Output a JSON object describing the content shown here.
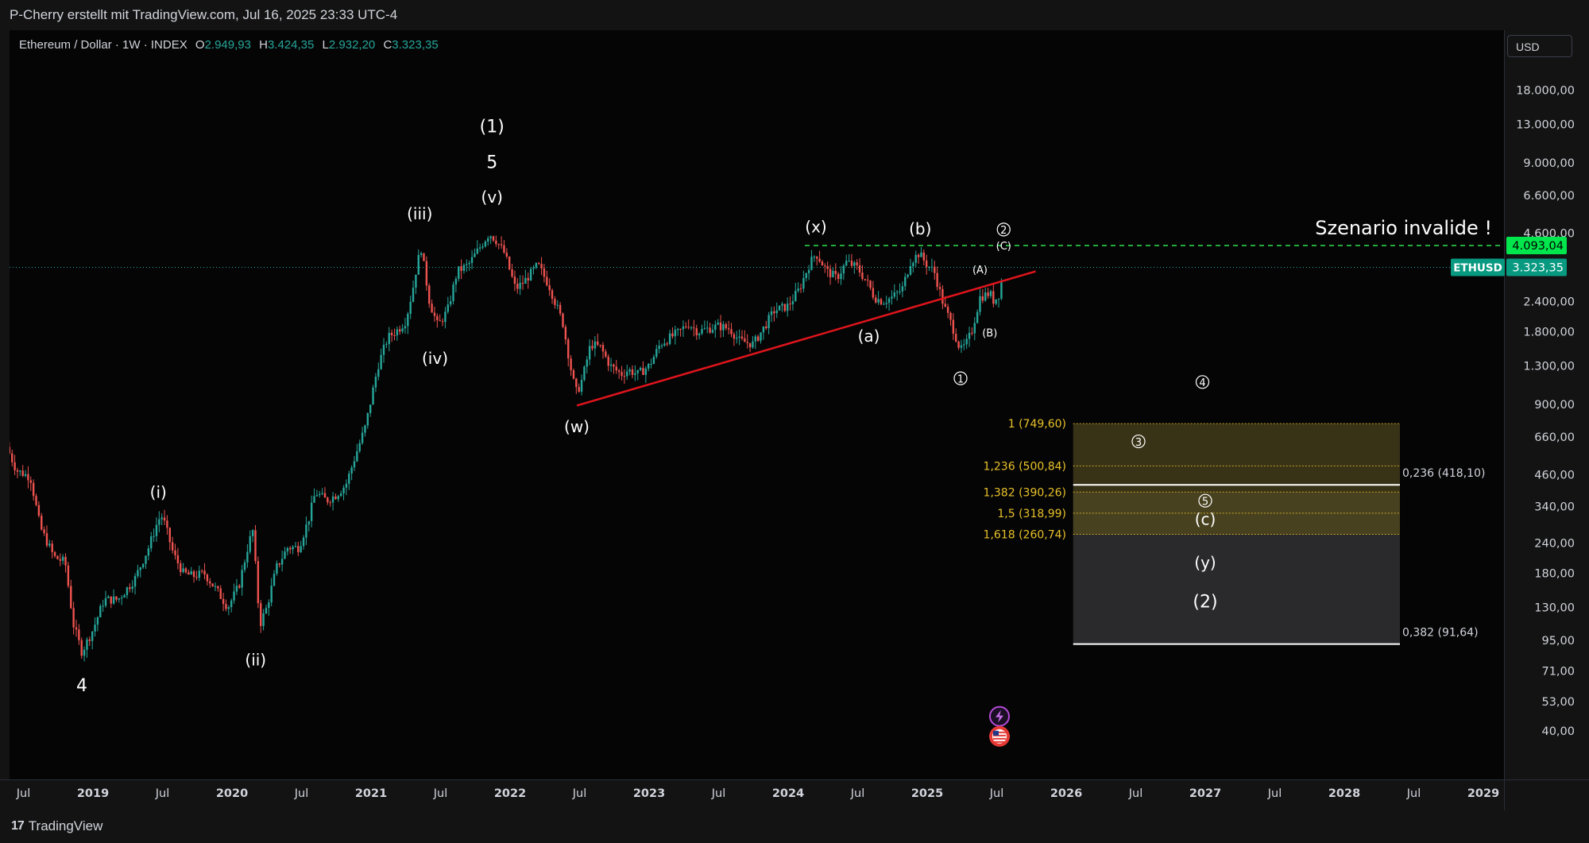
{
  "header": {
    "attribution": "P-Cherry erstellt mit TradingView.com, Jul 16, 2025 23:33 UTC-4"
  },
  "legend": {
    "symbol": "Ethereum / Dollar · 1W · INDEX",
    "open_label": "O",
    "open": "2.949,93",
    "high_label": "H",
    "high": "3.424,35",
    "low_label": "L",
    "low": "2.932,20",
    "close_label": "C",
    "close": "3.323,35"
  },
  "currency_button": "USD",
  "footer": {
    "brand": "TradingView",
    "brand_mark": "17"
  },
  "chart_data": {
    "type": "candlestick",
    "title": "Ethereum / Dollar · 1W · INDEX",
    "y_scale": "log",
    "ylim": [
      33,
      23000
    ],
    "y_ticks": [
      {
        "value": 18000,
        "label": "18.000,00"
      },
      {
        "value": 13000,
        "label": "13.000,00"
      },
      {
        "value": 9000,
        "label": "9.000,00"
      },
      {
        "value": 6600,
        "label": "6.600,00"
      },
      {
        "value": 4600,
        "label": "4.600,00"
      },
      {
        "value": 2400,
        "label": "2.400,00"
      },
      {
        "value": 1800,
        "label": "1.800,00"
      },
      {
        "value": 1300,
        "label": "1.300,00"
      },
      {
        "value": 900,
        "label": "900,00"
      },
      {
        "value": 660,
        "label": "660,00"
      },
      {
        "value": 460,
        "label": "460,00"
      },
      {
        "value": 340,
        "label": "340,00"
      },
      {
        "value": 240,
        "label": "240,00"
      },
      {
        "value": 180,
        "label": "180,00"
      },
      {
        "value": 130,
        "label": "130,00"
      },
      {
        "value": 95,
        "label": "95,00"
      },
      {
        "value": 71,
        "label": "71,00"
      },
      {
        "value": 53,
        "label": "53,00"
      },
      {
        "value": 40,
        "label": "40,00"
      }
    ],
    "x_ticks": [
      {
        "t": 2018.5,
        "label": "Jul",
        "bold": false
      },
      {
        "t": 2019.0,
        "label": "2019",
        "bold": true
      },
      {
        "t": 2019.5,
        "label": "Jul",
        "bold": false
      },
      {
        "t": 2020.0,
        "label": "2020",
        "bold": true
      },
      {
        "t": 2020.5,
        "label": "Jul",
        "bold": false
      },
      {
        "t": 2021.0,
        "label": "2021",
        "bold": true
      },
      {
        "t": 2021.5,
        "label": "Jul",
        "bold": false
      },
      {
        "t": 2022.0,
        "label": "2022",
        "bold": true
      },
      {
        "t": 2022.5,
        "label": "Jul",
        "bold": false
      },
      {
        "t": 2023.0,
        "label": "2023",
        "bold": true
      },
      {
        "t": 2023.5,
        "label": "Jul",
        "bold": false
      },
      {
        "t": 2024.0,
        "label": "2024",
        "bold": true
      },
      {
        "t": 2024.5,
        "label": "Jul",
        "bold": false
      },
      {
        "t": 2025.0,
        "label": "2025",
        "bold": true
      },
      {
        "t": 2025.5,
        "label": "Jul",
        "bold": false
      },
      {
        "t": 2026.0,
        "label": "2026",
        "bold": true
      },
      {
        "t": 2026.5,
        "label": "Jul",
        "bold": false
      },
      {
        "t": 2027.0,
        "label": "2027",
        "bold": true
      },
      {
        "t": 2027.5,
        "label": "Jul",
        "bold": false
      },
      {
        "t": 2028.0,
        "label": "2028",
        "bold": true
      },
      {
        "t": 2028.5,
        "label": "Jul",
        "bold": false
      },
      {
        "t": 2029.0,
        "label": "2029",
        "bold": true
      }
    ],
    "price_path": [
      [
        2018.38,
        600
      ],
      [
        2018.45,
        480
      ],
      [
        2018.55,
        450
      ],
      [
        2018.62,
        280
      ],
      [
        2018.72,
        210
      ],
      [
        2018.8,
        200
      ],
      [
        2018.86,
        110
      ],
      [
        2018.92,
        85
      ],
      [
        2019.0,
        105
      ],
      [
        2019.08,
        140
      ],
      [
        2019.18,
        140
      ],
      [
        2019.3,
        170
      ],
      [
        2019.4,
        230
      ],
      [
        2019.47,
        300
      ],
      [
        2019.5,
        310
      ],
      [
        2019.58,
        215
      ],
      [
        2019.65,
        180
      ],
      [
        2019.72,
        175
      ],
      [
        2019.8,
        180
      ],
      [
        2019.9,
        150
      ],
      [
        2019.97,
        130
      ],
      [
        2020.05,
        160
      ],
      [
        2020.12,
        240
      ],
      [
        2020.15,
        270
      ],
      [
        2020.2,
        110
      ],
      [
        2020.25,
        130
      ],
      [
        2020.32,
        190
      ],
      [
        2020.4,
        230
      ],
      [
        2020.48,
        230
      ],
      [
        2020.55,
        300
      ],
      [
        2020.6,
        390
      ],
      [
        2020.68,
        360
      ],
      [
        2020.75,
        380
      ],
      [
        2020.82,
        420
      ],
      [
        2020.9,
        580
      ],
      [
        2020.96,
        730
      ],
      [
        2021.05,
        1300
      ],
      [
        2021.12,
        1700
      ],
      [
        2021.2,
        1850
      ],
      [
        2021.25,
        2000
      ],
      [
        2021.3,
        2700
      ],
      [
        2021.33,
        3400
      ],
      [
        2021.36,
        4000
      ],
      [
        2021.42,
        2400
      ],
      [
        2021.48,
        1900
      ],
      [
        2021.55,
        2200
      ],
      [
        2021.62,
        3200
      ],
      [
        2021.7,
        3400
      ],
      [
        2021.78,
        4000
      ],
      [
        2021.85,
        4600
      ],
      [
        2021.9,
        4300
      ],
      [
        2021.96,
        3800
      ],
      [
        2022.04,
        2700
      ],
      [
        2022.1,
        2900
      ],
      [
        2022.2,
        3400
      ],
      [
        2022.28,
        2800
      ],
      [
        2022.38,
        1950
      ],
      [
        2022.45,
        1150
      ],
      [
        2022.48,
        1000
      ],
      [
        2022.52,
        1150
      ],
      [
        2022.58,
        1600
      ],
      [
        2022.65,
        1550
      ],
      [
        2022.72,
        1300
      ],
      [
        2022.8,
        1200
      ],
      [
        2022.85,
        1250
      ],
      [
        2022.92,
        1200
      ],
      [
        2023.0,
        1300
      ],
      [
        2023.08,
        1600
      ],
      [
        2023.15,
        1700
      ],
      [
        2023.22,
        1800
      ],
      [
        2023.28,
        1950
      ],
      [
        2023.35,
        1800
      ],
      [
        2023.42,
        1850
      ],
      [
        2023.5,
        1900
      ],
      [
        2023.58,
        1850
      ],
      [
        2023.65,
        1650
      ],
      [
        2023.75,
        1600
      ],
      [
        2023.82,
        1850
      ],
      [
        2023.9,
        2200
      ],
      [
        2024.0,
        2300
      ],
      [
        2024.08,
        2700
      ],
      [
        2024.15,
        3400
      ],
      [
        2024.2,
        3800
      ],
      [
        2024.28,
        3200
      ],
      [
        2024.35,
        3000
      ],
      [
        2024.42,
        3500
      ],
      [
        2024.5,
        3300
      ],
      [
        2024.58,
        2800
      ],
      [
        2024.62,
        2500
      ],
      [
        2024.68,
        2400
      ],
      [
        2024.75,
        2500
      ],
      [
        2024.82,
        2700
      ],
      [
        2024.88,
        3500
      ],
      [
        2024.94,
        3800
      ],
      [
        2025.0,
        3400
      ],
      [
        2025.05,
        3200
      ],
      [
        2025.12,
        2300
      ],
      [
        2025.18,
        1900
      ],
      [
        2025.24,
        1500
      ],
      [
        2025.28,
        1600
      ],
      [
        2025.32,
        1800
      ],
      [
        2025.38,
        2500
      ],
      [
        2025.45,
        2600
      ],
      [
        2025.48,
        2400
      ],
      [
        2025.52,
        2600
      ],
      [
        2025.55,
        3300
      ]
    ],
    "last_price": {
      "value": 3323.35,
      "label": "3.323,35",
      "ticker": "ETHUSD"
    },
    "invalidation": {
      "value": 4093.04,
      "label": "4.093,04",
      "text": "Szenario invalide !"
    },
    "trendline": [
      [
        2022.48,
        890
      ],
      [
        2025.78,
        3200
      ]
    ],
    "fib_extension": [
      {
        "ratio": "1",
        "value": 749.6,
        "label": "1 (749,60)"
      },
      {
        "ratio": "1,236",
        "value": 500.84,
        "label": "1,236 (500,84)"
      },
      {
        "ratio": "1,382",
        "value": 390.26,
        "label": "1,382 (390,26)"
      },
      {
        "ratio": "1,5",
        "value": 318.99,
        "label": "1,5 (318,99)"
      },
      {
        "ratio": "1,618",
        "value": 260.74,
        "label": "1,618 (260,74)"
      }
    ],
    "fib_retracement": [
      {
        "ratio": "0,236",
        "value": 418.1,
        "label": "0,236 (418,10)"
      },
      {
        "ratio": "0,382",
        "value": 91.64,
        "label": "0,382 (91,64)"
      }
    ],
    "zone": {
      "t_start": 2026.05,
      "t_end": 2028.4
    },
    "wave_labels": [
      {
        "text": "4",
        "t": 2018.92,
        "v": 62,
        "size": 22,
        "circled": false
      },
      {
        "text": "(i)",
        "t": 2019.47,
        "v": 390,
        "size": 20,
        "circled": false
      },
      {
        "text": "(ii)",
        "t": 2020.17,
        "v": 79,
        "size": 20,
        "circled": false
      },
      {
        "text": "(iii)",
        "t": 2021.35,
        "v": 5550,
        "size": 20,
        "circled": false
      },
      {
        "text": "(iv)",
        "t": 2021.46,
        "v": 1400,
        "size": 20,
        "circled": false
      },
      {
        "text": "(v)",
        "t": 2021.87,
        "v": 6500,
        "size": 20,
        "circled": false
      },
      {
        "text": "5",
        "t": 2021.87,
        "v": 9100,
        "size": 22,
        "circled": false
      },
      {
        "text": "(1)",
        "t": 2021.87,
        "v": 12800,
        "size": 22,
        "circled": false
      },
      {
        "text": "(w)",
        "t": 2022.48,
        "v": 730,
        "size": 20,
        "circled": false
      },
      {
        "text": "(x)",
        "t": 2024.2,
        "v": 4900,
        "size": 20,
        "circled": false
      },
      {
        "text": "(a)",
        "t": 2024.58,
        "v": 1730,
        "size": 20,
        "circled": false
      },
      {
        "text": "(b)",
        "t": 2024.95,
        "v": 4800,
        "size": 20,
        "circled": false
      },
      {
        "text": "(A)",
        "t": 2025.38,
        "v": 3250,
        "size": 13,
        "circled": false
      },
      {
        "text": "(B)",
        "t": 2025.45,
        "v": 1780,
        "size": 13,
        "circled": false
      },
      {
        "text": "(C)",
        "t": 2025.55,
        "v": 4080,
        "size": 13,
        "circled": false
      },
      {
        "text": "1",
        "t": 2025.24,
        "v": 1150,
        "size": 13,
        "circled": true
      },
      {
        "text": "2",
        "t": 2025.55,
        "v": 4750,
        "size": 13,
        "circled": true
      },
      {
        "text": "3",
        "t": 2026.52,
        "v": 630,
        "size": 13,
        "circled": true
      },
      {
        "text": "4",
        "t": 2026.98,
        "v": 1110,
        "size": 13,
        "circled": true
      },
      {
        "text": "5",
        "t": 2027.0,
        "v": 358,
        "size": 13,
        "circled": true
      },
      {
        "text": "(c)",
        "t": 2027.0,
        "v": 302,
        "size": 20,
        "circled": false
      },
      {
        "text": "(y)",
        "t": 2027.0,
        "v": 200,
        "size": 20,
        "circled": false
      },
      {
        "text": "(2)",
        "t": 2027.0,
        "v": 138,
        "size": 22,
        "circled": false
      }
    ],
    "event_icons": [
      {
        "name": "lightning-icon",
        "t": 2025.52,
        "v": 46
      },
      {
        "name": "us-flag-icon",
        "t": 2025.52,
        "v": 38
      }
    ],
    "colors": {
      "up": "#26a69a",
      "down": "#ef5350",
      "trendline": "#e0141c",
      "invalidation": "#2ee24f",
      "fib_ext": "#e8c12a",
      "last_price_bg": "#089981",
      "zone_top": "#3b3518",
      "zone_bottom": "#2a2a2c"
    }
  }
}
